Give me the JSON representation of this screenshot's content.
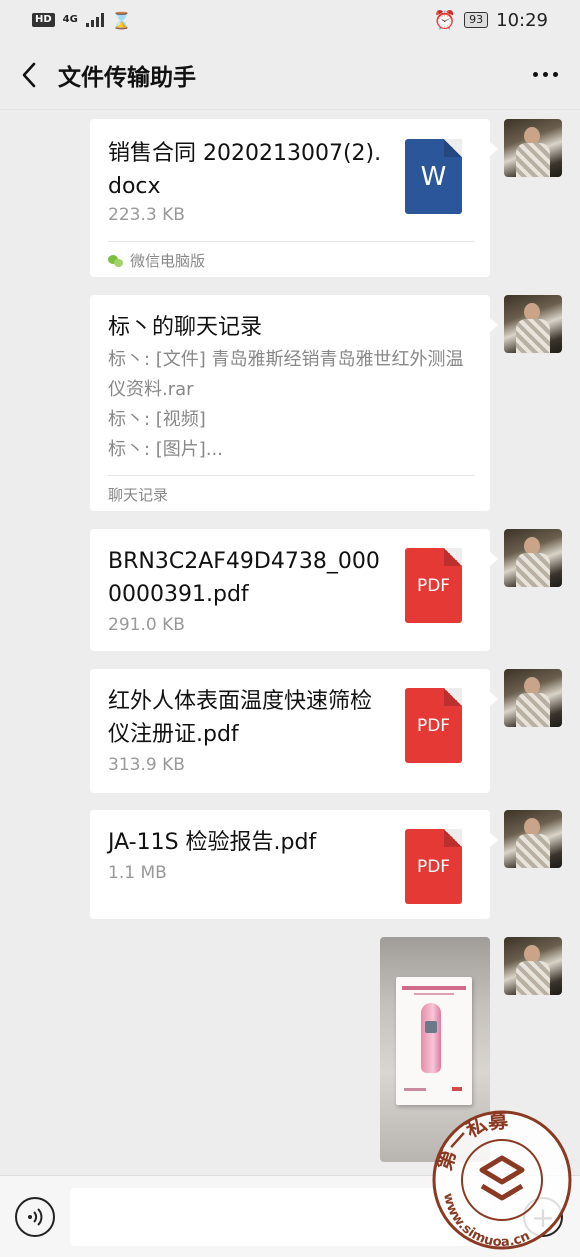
{
  "status_bar": {
    "hd": "HD",
    "network": "4G",
    "battery": "93",
    "time": "10:29"
  },
  "header": {
    "title": "文件传输助手",
    "back_icon": "chevron-left-icon",
    "more_icon": "more-dots-icon"
  },
  "messages": [
    {
      "type": "file",
      "name": "销售合同 2020213007(2).docx",
      "size": "223.3 KB",
      "icon": "W",
      "source": "微信电脑版"
    },
    {
      "type": "chat-record",
      "title": "标丶的聊天记录",
      "lines": [
        "标丶: [文件] 青岛雅斯经销青岛雅世红外测温仪资料.rar",
        "标丶: [视频]",
        "标丶: [图片]..."
      ],
      "footer": "聊天记录"
    },
    {
      "type": "file",
      "name": "BRN3C2AF49D4738_0000000391.pdf",
      "size": "291.0 KB",
      "icon": "PDF"
    },
    {
      "type": "file",
      "name": "红外人体表面温度快速筛检仪注册证.pdf",
      "size": "313.9 KB",
      "icon": "PDF"
    },
    {
      "type": "file",
      "name": "JA-11S 检验报告.pdf",
      "size": "1.1 MB",
      "icon": "PDF"
    },
    {
      "type": "image"
    }
  ],
  "input_bar": {
    "value": ""
  },
  "watermark": {
    "text_top": "第一私募",
    "text_bottom": "www.simuoa.cn"
  }
}
